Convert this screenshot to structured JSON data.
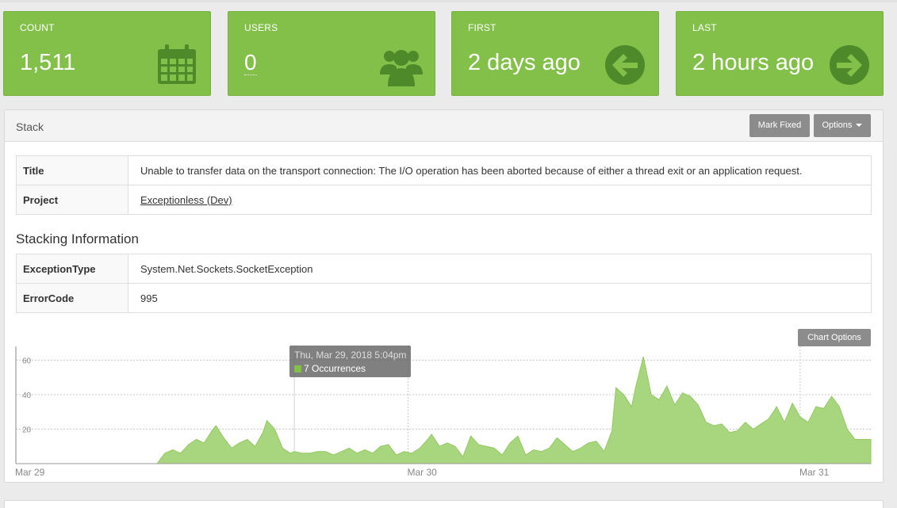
{
  "stats": {
    "count": {
      "label": "COUNT",
      "value": "1,511",
      "icon": "calendar-icon"
    },
    "users": {
      "label": "USERS",
      "value": "0",
      "icon": "users-icon"
    },
    "first": {
      "label": "FIRST",
      "value": "2 days ago",
      "icon": "arrow-circle-left-icon"
    },
    "last": {
      "label": "LAST",
      "value": "2 hours ago",
      "icon": "arrow-circle-right-icon"
    }
  },
  "panel": {
    "title": "Stack",
    "mark_fixed": "Mark Fixed",
    "options": "Options"
  },
  "details": [
    {
      "key": "Title",
      "value": "Unable to transfer data on the transport connection: The I/O operation has been aborted because of either a thread exit or an application request."
    },
    {
      "key": "Project",
      "value": "Exceptionless (Dev)"
    }
  ],
  "stacking": {
    "heading": "Stacking Information",
    "rows": [
      {
        "key": "ExceptionType",
        "value": "System.Net.Sockets.SocketException"
      },
      {
        "key": "ErrorCode",
        "value": "995"
      }
    ]
  },
  "chart_options": "Chart Options",
  "tooltip": {
    "date": "Thu, Mar 29, 2018 5:04pm",
    "text": "7 Occurrences"
  },
  "colors": {
    "green": "#82c04a",
    "fill": "#a8d67e",
    "panel_button": "#8c8c8c"
  },
  "chart_data": {
    "type": "area",
    "title": "",
    "xlabel": "",
    "ylabel": "",
    "x_ticks": [
      "Mar 29",
      "Mar 30",
      "Mar 31"
    ],
    "y_ticks": [
      20,
      40,
      60
    ],
    "ylim": [
      0,
      68
    ],
    "x_range_days": [
      0,
      2.18
    ],
    "grid": true,
    "series": [
      {
        "points": [
          [
            0.0,
            0
          ],
          [
            0.36,
            0
          ],
          [
            0.38,
            6
          ],
          [
            0.4,
            8
          ],
          [
            0.42,
            6
          ],
          [
            0.44,
            11
          ],
          [
            0.46,
            14
          ],
          [
            0.48,
            12
          ],
          [
            0.5,
            19
          ],
          [
            0.51,
            22
          ],
          [
            0.53,
            15
          ],
          [
            0.55,
            9
          ],
          [
            0.57,
            12
          ],
          [
            0.59,
            14
          ],
          [
            0.61,
            10
          ],
          [
            0.63,
            18
          ],
          [
            0.64,
            25
          ],
          [
            0.66,
            20
          ],
          [
            0.68,
            9
          ],
          [
            0.7,
            6
          ],
          [
            0.71,
            7
          ],
          [
            0.73,
            6
          ],
          [
            0.75,
            6
          ],
          [
            0.77,
            7
          ],
          [
            0.79,
            7
          ],
          [
            0.81,
            5
          ],
          [
            0.83,
            7
          ],
          [
            0.85,
            9
          ],
          [
            0.87,
            6
          ],
          [
            0.89,
            8
          ],
          [
            0.91,
            6
          ],
          [
            0.93,
            10
          ],
          [
            0.95,
            11
          ],
          [
            0.97,
            5
          ],
          [
            0.99,
            7
          ],
          [
            1.01,
            6
          ],
          [
            1.03,
            9
          ],
          [
            1.05,
            14
          ],
          [
            1.06,
            17
          ],
          [
            1.08,
            10
          ],
          [
            1.1,
            12
          ],
          [
            1.12,
            10
          ],
          [
            1.14,
            4
          ],
          [
            1.16,
            16
          ],
          [
            1.18,
            11
          ],
          [
            1.2,
            10
          ],
          [
            1.22,
            9
          ],
          [
            1.24,
            5
          ],
          [
            1.26,
            12
          ],
          [
            1.28,
            16
          ],
          [
            1.3,
            5
          ],
          [
            1.32,
            8
          ],
          [
            1.34,
            7
          ],
          [
            1.36,
            9
          ],
          [
            1.38,
            15
          ],
          [
            1.4,
            11
          ],
          [
            1.42,
            7
          ],
          [
            1.44,
            9
          ],
          [
            1.46,
            12
          ],
          [
            1.48,
            13
          ],
          [
            1.5,
            7
          ],
          [
            1.52,
            19
          ],
          [
            1.53,
            44
          ],
          [
            1.55,
            40
          ],
          [
            1.57,
            33
          ],
          [
            1.58,
            44
          ],
          [
            1.6,
            62
          ],
          [
            1.62,
            40
          ],
          [
            1.64,
            37
          ],
          [
            1.66,
            45
          ],
          [
            1.68,
            34
          ],
          [
            1.7,
            41
          ],
          [
            1.72,
            39
          ],
          [
            1.74,
            34
          ],
          [
            1.76,
            24
          ],
          [
            1.78,
            22
          ],
          [
            1.8,
            23
          ],
          [
            1.82,
            18
          ],
          [
            1.84,
            19
          ],
          [
            1.86,
            24
          ],
          [
            1.88,
            20
          ],
          [
            1.9,
            23
          ],
          [
            1.92,
            26
          ],
          [
            1.94,
            33
          ],
          [
            1.96,
            24
          ],
          [
            1.98,
            35
          ],
          [
            2.0,
            27
          ],
          [
            2.02,
            24
          ],
          [
            2.04,
            33
          ],
          [
            2.06,
            32
          ],
          [
            2.08,
            39
          ],
          [
            2.1,
            33
          ],
          [
            2.12,
            20
          ],
          [
            2.14,
            14
          ],
          [
            2.18,
            14
          ]
        ]
      }
    ]
  }
}
